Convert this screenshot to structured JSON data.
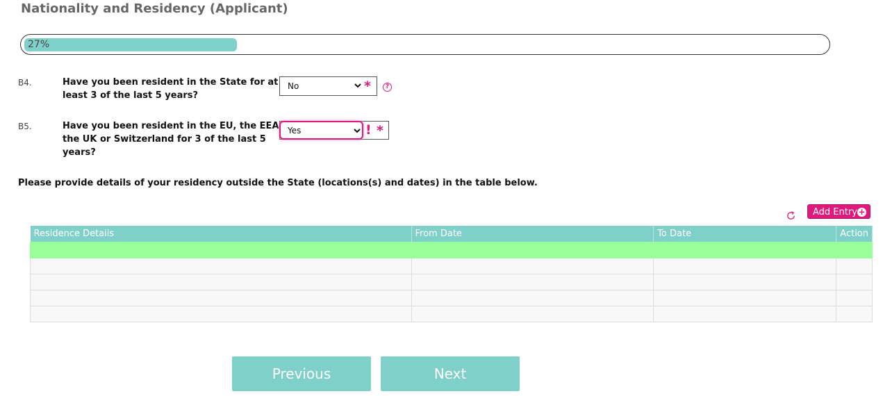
{
  "page": {
    "title": "Nationality and Residency (Applicant)"
  },
  "progress": {
    "label": "27%",
    "value": 0.27
  },
  "questions": [
    {
      "number": "B4.",
      "line1": "Have you been resident in the State for at",
      "line2": "least 3 of the last 5 years?",
      "answer": "No",
      "required_mark": "*",
      "help_icon": "question-circle-icon"
    },
    {
      "number": "B5.",
      "line1": "Have you been resident in the EU, the EEA,",
      "line2": "the UK or Switzerland for 3 of the last 5",
      "line3": "years?",
      "answer": "Yes",
      "error_mark": "!",
      "required_mark": "*"
    }
  ],
  "instruction": "Please provide details of your residency outside the State (locations(s) and dates) in the table below.",
  "table": {
    "columns": [
      "Residence Details",
      "From Date",
      "To Date",
      "Action"
    ],
    "add_button_label": "Add Entry",
    "refresh_icon": "refresh-icon",
    "rows": 5
  },
  "nav": {
    "previous_label": "Previous",
    "next_label": "Next"
  },
  "colors": {
    "accent": "#7fd0c8",
    "required": "#e0197d",
    "selected_row": "#99ff99"
  }
}
